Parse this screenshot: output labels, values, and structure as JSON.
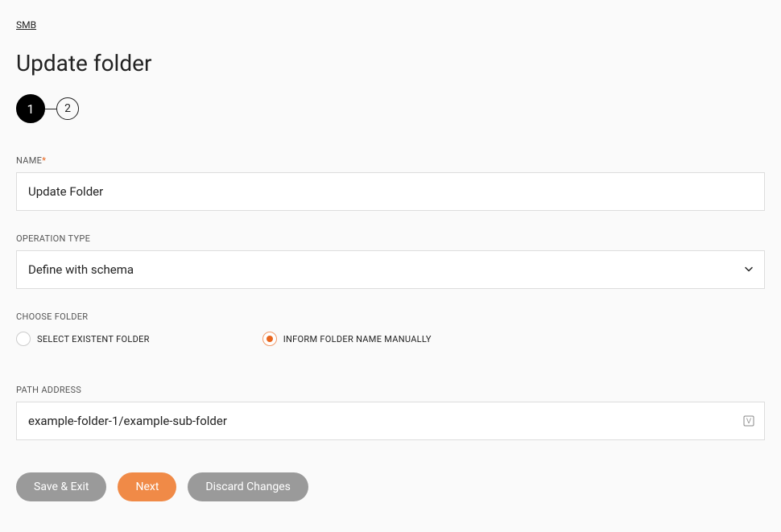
{
  "breadcrumb": "SMB",
  "pageTitle": "Update folder",
  "stepper": {
    "step1": "1",
    "step2": "2"
  },
  "fields": {
    "name": {
      "label": "NAME",
      "required": "*",
      "value": "Update Folder"
    },
    "operationType": {
      "label": "OPERATION TYPE",
      "value": "Define with schema"
    },
    "chooseFolder": {
      "label": "CHOOSE FOLDER",
      "options": {
        "selectExistent": "SELECT EXISTENT FOLDER",
        "informManually": "INFORM FOLDER NAME MANUALLY"
      }
    },
    "pathAddress": {
      "label": "PATH ADDRESS",
      "value": "example-folder-1/example-sub-folder"
    }
  },
  "buttons": {
    "saveExit": "Save & Exit",
    "next": "Next",
    "discard": "Discard Changes"
  }
}
